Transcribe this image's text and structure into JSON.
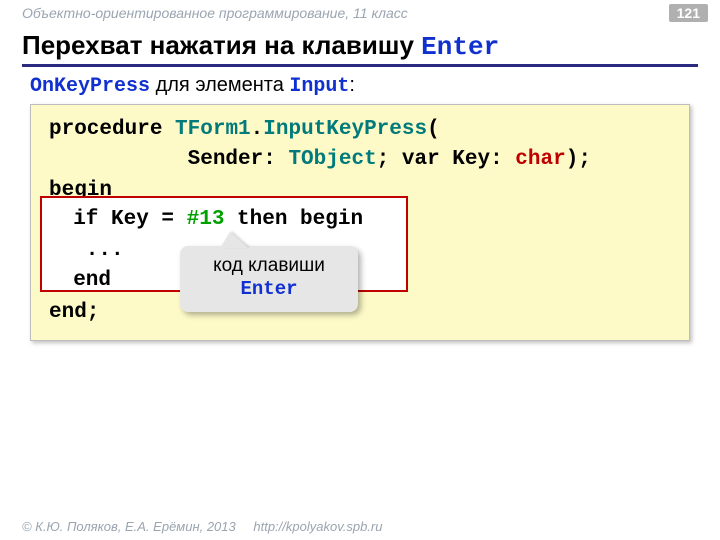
{
  "header": {
    "course": "Объектно-ориентированное программирование, 11 класс",
    "page": "121"
  },
  "title": {
    "prefix": "Перехват нажатия на клавишу ",
    "enter": "Enter"
  },
  "subtitle": {
    "onkeypress": "OnKeyPress",
    "mid": " для элемента ",
    "input": "Input",
    "tail": ":"
  },
  "code": {
    "l1_a": "procedure ",
    "l1_b": "TForm1",
    "l1_c": ".",
    "l1_d": "InputKeyPress",
    "l1_e": "(",
    "l2_a": "           Sender: ",
    "l2_b": "TObject",
    "l2_c": "; var Key: ",
    "l2_d": "char",
    "l2_e": ");",
    "l3": "begin",
    "l4_a": "  if Key = ",
    "l4_b": "#13",
    "l4_c": " then begin",
    "l5": "   ...",
    "l6": "  end",
    "l7": "end;"
  },
  "callout": {
    "line1": "код клавиши",
    "enter": "Enter"
  },
  "footer": {
    "copyright": "© К.Ю. Поляков, Е.А. Ерёмин, 2013",
    "url": "http://kpolyakov.spb.ru"
  }
}
